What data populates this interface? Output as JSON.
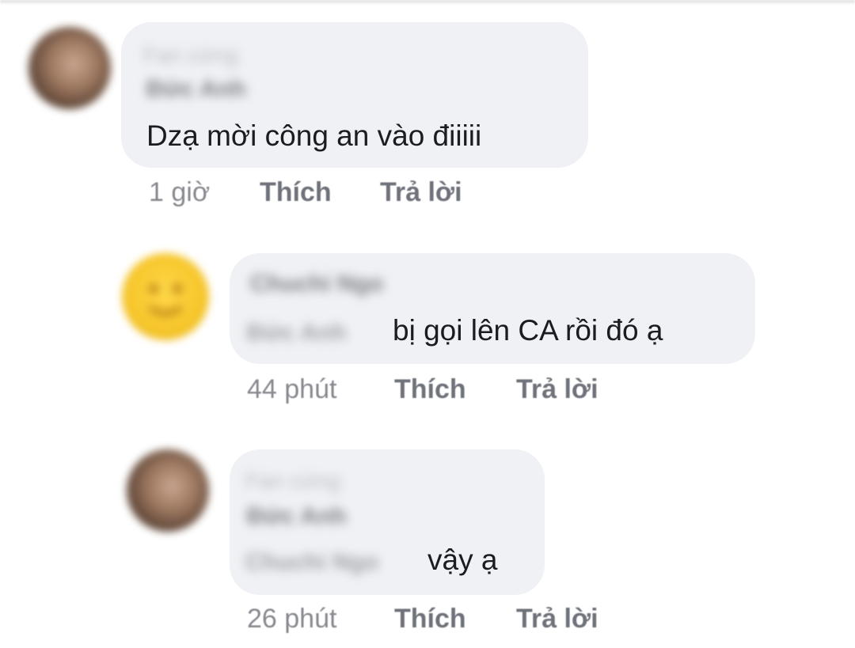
{
  "comments": [
    {
      "author_blurred": "Đức Anh",
      "badge_blurred": "Fan cứng",
      "text": "Dzạ mời công an vào điiiii",
      "time": "1 giờ",
      "like_label": "Thích",
      "reply_label": "Trả lời"
    },
    {
      "author_blurred": "Chuchi Ngo",
      "mention_blurred": "Đức Anh",
      "text": "bị gọi lên CA rồi đó ạ",
      "time": "44 phút",
      "like_label": "Thích",
      "reply_label": "Trả lời"
    },
    {
      "author_blurred": "Đức Anh",
      "badge_blurred": "Fan cứng",
      "mention_blurred": "Chuchi Ngo",
      "text": "vậy ạ",
      "time": "26 phút",
      "like_label": "Thích",
      "reply_label": "Trả lời"
    }
  ]
}
